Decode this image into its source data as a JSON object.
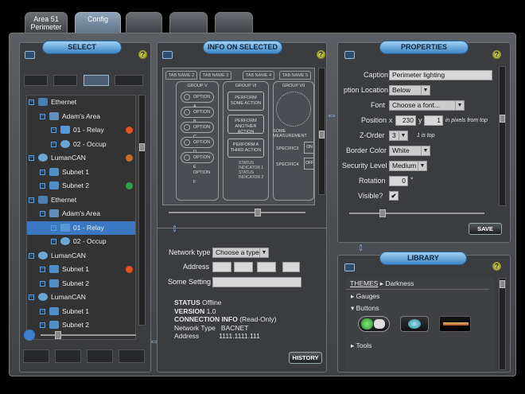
{
  "tabs": [
    {
      "label": "Area 51 Perimeter",
      "active": false
    },
    {
      "label": "Config",
      "active": true
    },
    {
      "label": "",
      "active": false
    },
    {
      "label": "",
      "active": false
    },
    {
      "label": "",
      "active": false
    }
  ],
  "select": {
    "title": "SELECT",
    "help": "?",
    "tree": [
      {
        "label": "Ethernet",
        "level": 0,
        "icon": "network",
        "sel": false,
        "badge": ""
      },
      {
        "label": "Adam's Area",
        "level": 1,
        "icon": "building",
        "sel": false,
        "badge": ""
      },
      {
        "label": "01 - Relay",
        "level": 2,
        "icon": "relay",
        "sel": false,
        "badge": "red"
      },
      {
        "label": "02 - Occup",
        "level": 2,
        "icon": "occupancy",
        "sel": false,
        "badge": ""
      },
      {
        "label": "LumanCAN",
        "level": 0,
        "icon": "swirl",
        "sel": false,
        "badge": "orange"
      },
      {
        "label": "Subnet 1",
        "level": 1,
        "icon": "subnet",
        "sel": false,
        "badge": ""
      },
      {
        "label": "Subnet 2",
        "level": 1,
        "icon": "subnet",
        "sel": false,
        "badge": "green"
      },
      {
        "label": "Ethernet",
        "level": 0,
        "icon": "network",
        "sel": false,
        "badge": ""
      },
      {
        "label": "Adam's Area",
        "level": 1,
        "icon": "building",
        "sel": false,
        "badge": ""
      },
      {
        "label": "01 - Relay",
        "level": 2,
        "icon": "relay",
        "sel": true,
        "badge": ""
      },
      {
        "label": "02 - Occup",
        "level": 2,
        "icon": "occupancy",
        "sel": false,
        "badge": ""
      },
      {
        "label": "LumanCAN",
        "level": 0,
        "icon": "swirl",
        "sel": false,
        "badge": ""
      },
      {
        "label": "Subnet 1",
        "level": 1,
        "icon": "subnet",
        "sel": false,
        "badge": "red"
      },
      {
        "label": "Subnet 2",
        "level": 1,
        "icon": "subnet",
        "sel": false,
        "badge": ""
      },
      {
        "label": "LumanCAN",
        "level": 0,
        "icon": "swirl",
        "sel": false,
        "badge": ""
      },
      {
        "label": "Subnet 1",
        "level": 1,
        "icon": "subnet",
        "sel": false,
        "badge": ""
      },
      {
        "label": "Subnet 2",
        "level": 1,
        "icon": "subnet",
        "sel": false,
        "badge": ""
      }
    ]
  },
  "info": {
    "title": "INFO ON SELECTED",
    "help": "?",
    "design_tabs": [
      "TAB NAME 2",
      "TAB NAME 3",
      "TAB NAME 4",
      "TAB NAME 5"
    ],
    "groups": [
      "GROUP V",
      "GROUP VI",
      "GROUP VII"
    ],
    "options": [
      "OPTION A",
      "OPTION B",
      "OPTION C",
      "OPTION D",
      "OPTION E",
      "OPTION F"
    ],
    "perform": [
      "PERFORM SOME ACTION",
      "PERFORM ANOTHER ACTION",
      "PERFORM A THIRD ACTION"
    ],
    "status_indicators": [
      "STATUS INDICATOR 1",
      "STATUS INDICATOR 2"
    ],
    "some_measurement": "SOME MEASUREMENT",
    "specific3": "SPECIFIC3",
    "specific4": "SPECIFIC4",
    "on": "ON",
    "off": "OFF",
    "network_type_label": "Network type",
    "network_type_value": "Choose a type",
    "address_label": "Address",
    "some_setting_label": "Some Setting",
    "status_key": "STATUS",
    "status_value": "Offline",
    "version_key": "VERSION",
    "version_value": "1.0",
    "conn_key": "CONNECTION INFO",
    "conn_value": "(Read-Only)",
    "nt_key": "Network Type",
    "nt_value": "BACNET",
    "addr_key": "Address",
    "addr_value": "1111.1111.111",
    "history_button": "HISTORY"
  },
  "properties": {
    "title": "PROPERTIES",
    "help": "?",
    "caption_label": "Caption",
    "caption_value": "Perimeter lighting",
    "caption_location_label": "ption Location",
    "caption_location_value": "Below",
    "font_label": "Font",
    "font_value": "Choose a font...",
    "position_label": "Position",
    "x_label": "x",
    "x_value": "230",
    "y_label": "y",
    "y_value": "1",
    "position_note": "in pixels from top",
    "zorder_label": "Z-Order",
    "zorder_value": "3",
    "zorder_note": "1 is top",
    "border_color_label": "Border Color",
    "border_color_value": "White",
    "security_label": "Security Level",
    "security_value": "Medium",
    "rotation_label": "Rotation",
    "rotation_value": "0",
    "rotation_unit": "°",
    "visible_label": "Visible?",
    "visible_value": "✔",
    "save_button": "SAVE"
  },
  "library": {
    "title": "LIBRARY",
    "help": "?",
    "breadcrumb_root": "THEMES",
    "breadcrumb_sep": "▸",
    "breadcrumb_current": "Darkness",
    "gauges": "Gauges",
    "buttons": "Buttons",
    "tools": "Tools"
  }
}
